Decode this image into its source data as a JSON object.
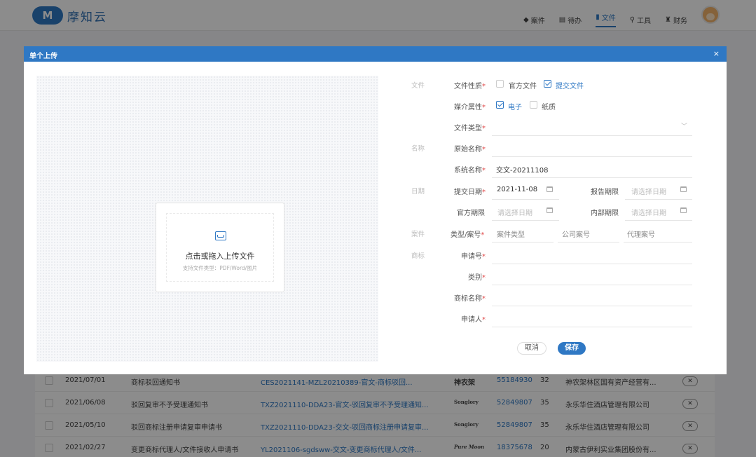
{
  "app": {
    "logo_letter": "M",
    "name": "摩知云"
  },
  "nav": [
    {
      "icon": "briefcase-icon",
      "glyph": "◆",
      "label": "案件"
    },
    {
      "icon": "inbox-icon",
      "glyph": "▤",
      "label": "待办"
    },
    {
      "icon": "file-icon",
      "glyph": "▮",
      "label": "文件"
    },
    {
      "icon": "search-icon",
      "glyph": "⚲",
      "label": "工具"
    },
    {
      "icon": "money-bag-icon",
      "glyph": "♜",
      "label": "财务"
    }
  ],
  "modal": {
    "title": "单个上传",
    "close": "×",
    "upload": {
      "title": "点击或拖入上传文件",
      "hint": "支持文件类型：PDF/Word/图片"
    },
    "sections": {
      "file": "文件",
      "name": "名称",
      "date": "日期",
      "case": "案件",
      "trademark": "商标"
    },
    "form": {
      "file_nature_label": "文件性质",
      "file_nature_options": [
        {
          "label": "官方文件",
          "checked": false
        },
        {
          "label": "提交文件",
          "checked": true
        }
      ],
      "media_label": "媒介属性",
      "media_options": [
        {
          "label": "电子",
          "checked": true
        },
        {
          "label": "纸质",
          "checked": false
        }
      ],
      "file_type_label": "文件类型",
      "file_type_value": "",
      "original_name_label": "原始名称",
      "original_name_value": "",
      "system_name_label": "系统名称",
      "system_name_value": "交文-20211108",
      "submit_date_label": "提交日期",
      "submit_date_value": "2021-11-08",
      "report_deadline_label": "报告期限",
      "official_deadline_label": "官方期限",
      "internal_deadline_label": "内部期限",
      "date_placeholder": "请选择日期",
      "case_type_label": "类型/案号",
      "case_type_placeholder": "案件类型",
      "company_no_placeholder": "公司案号",
      "agent_no_placeholder": "代理案号",
      "app_no_label": "申请号",
      "class_label": "类别",
      "tm_name_label": "商标名称",
      "applicant_label": "申请人"
    },
    "buttons": {
      "cancel": "取消",
      "save": "保存"
    }
  },
  "bg_table": [
    {
      "date": "2021/07/01",
      "name": "商标驳回通知书",
      "file": "CES2021141-MZL20210389-官文-商标驳回...",
      "brand": "神农架",
      "num": "55184930",
      "cls": "32",
      "owner": "神农架林区国有资产经营有..."
    },
    {
      "date": "2021/06/08",
      "name": "驳回复审不予受理通知书",
      "file": "TXZ2021110-DDA23-官文-驳回复审不予受理通知...",
      "brand": "Songlory",
      "num": "52849807",
      "cls": "35",
      "owner": "永乐华住酒店管理有限公司"
    },
    {
      "date": "2021/05/10",
      "name": "驳回商标注册申请复审申请书",
      "file": "TXZ2021110-DDA23-交文-驳回商标注册申请复审...",
      "brand": "Songlory",
      "num": "52849807",
      "cls": "35",
      "owner": "永乐华住酒店管理有限公司"
    },
    {
      "date": "2021/02/27",
      "name": "变更商标代理人/文件接收人申请书",
      "file": "YL2021106-sgdsww-交文-变更商标代理人/文件...",
      "brand": "Pure Moon",
      "num": "18375678",
      "cls": "20",
      "owner": "内蒙古伊利实业集团股份有..."
    }
  ]
}
